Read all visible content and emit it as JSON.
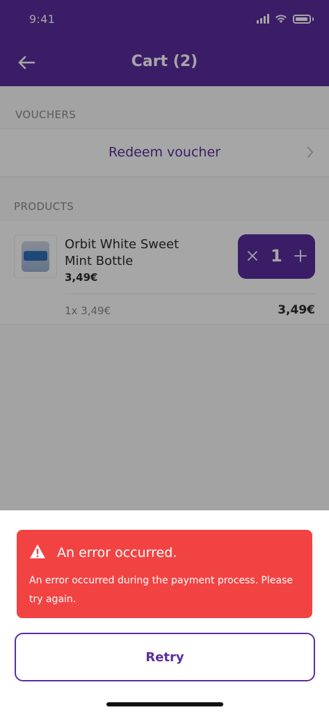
{
  "status_bar": {
    "time": "9:41",
    "icons": [
      "signal-icon",
      "wifi-icon",
      "battery-icon"
    ]
  },
  "header": {
    "title": "Cart (2)",
    "back_icon": "arrow-left-icon"
  },
  "vouchers": {
    "section_label": "VOUCHERS",
    "redeem_label": "Redeem voucher"
  },
  "products": {
    "section_label": "PRODUCTS",
    "items": [
      {
        "name": "Orbit White Sweet Mint Bottle",
        "price": "3,49€",
        "quantity": "1",
        "unit_line": "1x 3,49€",
        "total": "3,49€"
      }
    ]
  },
  "error": {
    "title": "An error occurred.",
    "message": "An error occurred during the payment process. Please try again."
  },
  "actions": {
    "retry_label": "Retry"
  },
  "colors": {
    "brand": "#5b2d9e",
    "error": "#f24343",
    "overlay": "rgba(0,0,0,0.35)"
  }
}
